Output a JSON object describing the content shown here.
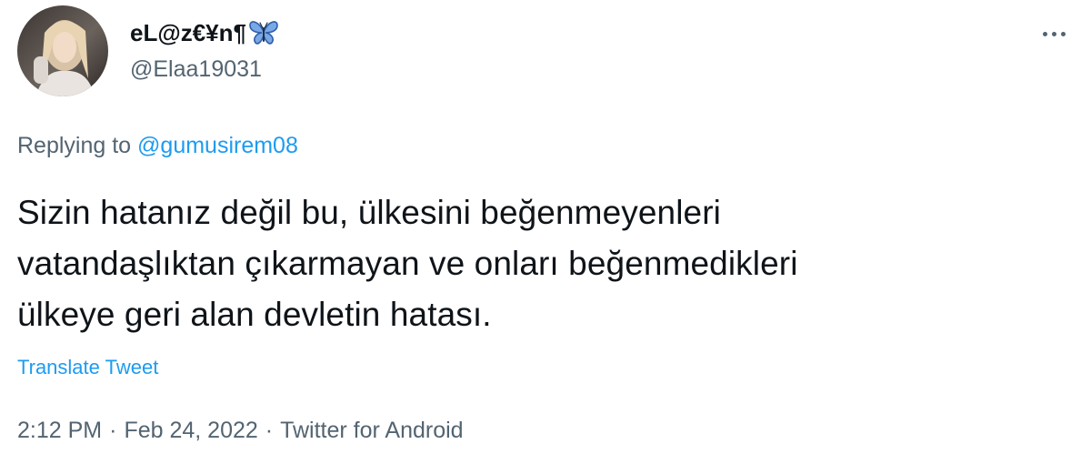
{
  "author": {
    "display_name": "eL@z€¥n¶",
    "badge_icon": "butterfly-emoji-icon",
    "handle": "@Elaa19031",
    "avatar_icon": "profile-photo-avatar"
  },
  "menu": {
    "more_icon": "more-options-icon"
  },
  "reply": {
    "prefix": "Replying to",
    "mention": "@gumusirem08"
  },
  "tweet": {
    "lines": [
      "Sizin hatanız değil bu, ülkesini beğenmeyenleri",
      "vatandaşlıktan çıkarmayan ve onları beğenmedikleri",
      "ülkeye geri alan devletin hatası."
    ]
  },
  "translate_label": "Translate Tweet",
  "meta": {
    "time": "2:12 PM",
    "separator": "·",
    "date": "Feb 24, 2022",
    "source": "Twitter for Android"
  },
  "colors": {
    "accent": "#1d9bf0",
    "secondary_text": "#536471",
    "primary_text": "#0f1419",
    "butterfly": "#5b8fd8"
  }
}
